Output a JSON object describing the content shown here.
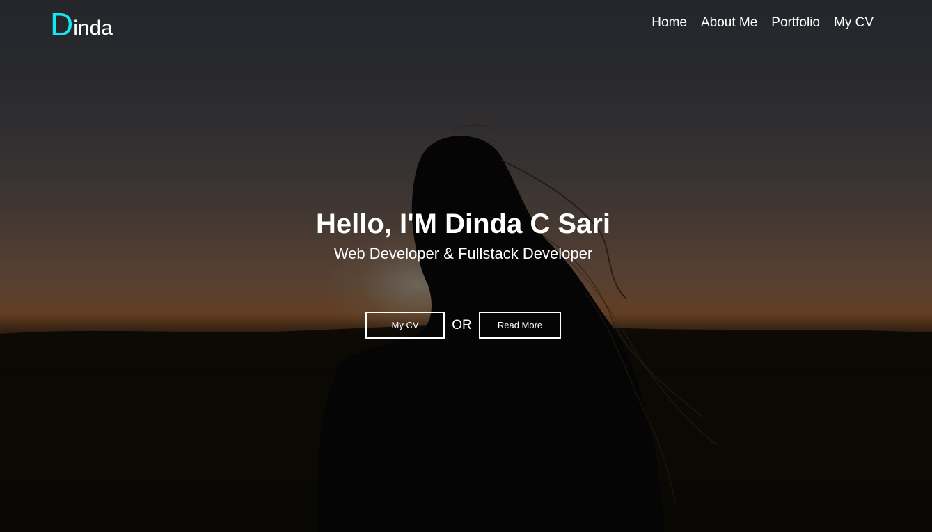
{
  "brand": {
    "first_letter": "D",
    "rest": "inda",
    "accent_color": "#17e6ee"
  },
  "nav": {
    "items": [
      {
        "label": "Home"
      },
      {
        "label": "About Me"
      },
      {
        "label": "Portfolio"
      },
      {
        "label": "My CV"
      }
    ]
  },
  "hero": {
    "headline": "Hello, I'M Dinda C Sari",
    "subtitle": "Web Developer & Fullstack Developer",
    "cv_button": "My CV",
    "separator": "OR",
    "read_more_button": "Read More"
  }
}
